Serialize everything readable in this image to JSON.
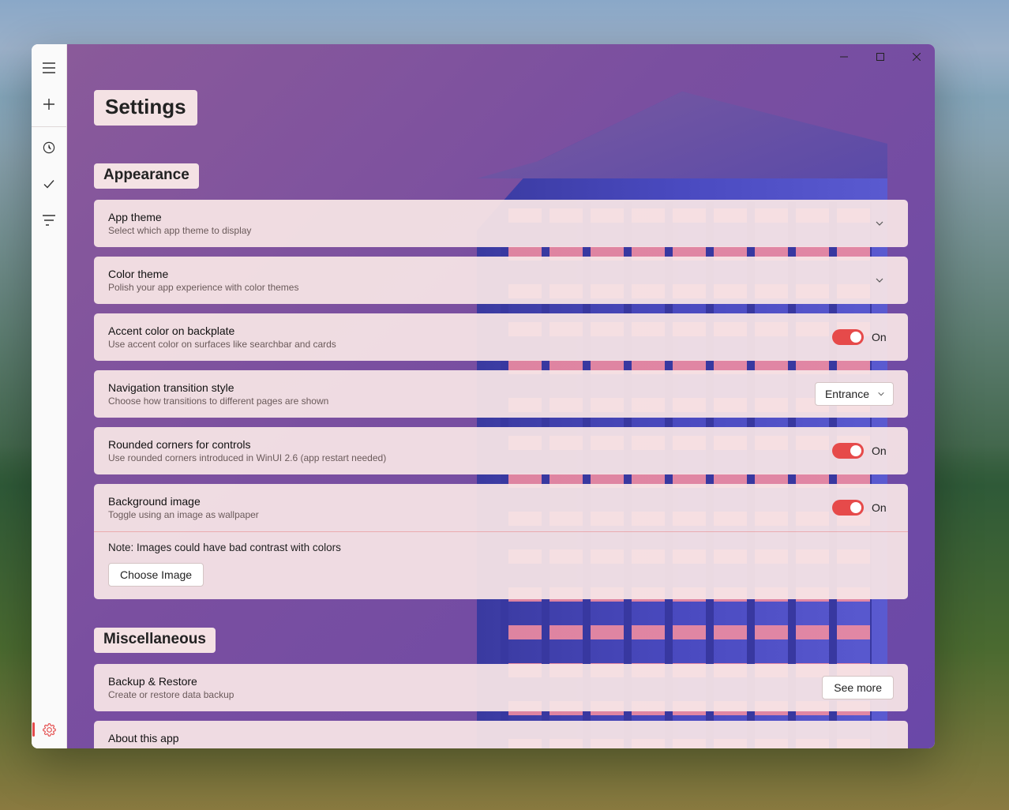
{
  "page": {
    "title": "Settings"
  },
  "sections": {
    "appearance": {
      "title": "Appearance",
      "app_theme": {
        "title": "App theme",
        "sub": "Select which app theme to display"
      },
      "color_theme": {
        "title": "Color theme",
        "sub": "Polish your app experience with color themes"
      },
      "accent": {
        "title": "Accent color on backplate",
        "sub": "Use accent color on surfaces like searchbar and cards",
        "state": "On"
      },
      "nav": {
        "title": "Navigation transition style",
        "sub": "Choose how transitions to different pages are shown",
        "value": "Entrance"
      },
      "rounded": {
        "title": "Rounded corners for controls",
        "sub": "Use rounded corners introduced in WinUI 2.6 (app restart needed)",
        "state": "On"
      },
      "bg": {
        "title": "Background image",
        "sub": "Toggle using an image as wallpaper",
        "state": "On",
        "note": "Note: Images could have bad contrast with colors",
        "choose": "Choose Image"
      }
    },
    "misc": {
      "title": "Miscellaneous",
      "backup": {
        "title": "Backup & Restore",
        "sub": "Create or restore data backup",
        "action": "See more"
      },
      "about": {
        "title": "About this app"
      }
    }
  },
  "colors": {
    "accent": "#e64a4a"
  }
}
